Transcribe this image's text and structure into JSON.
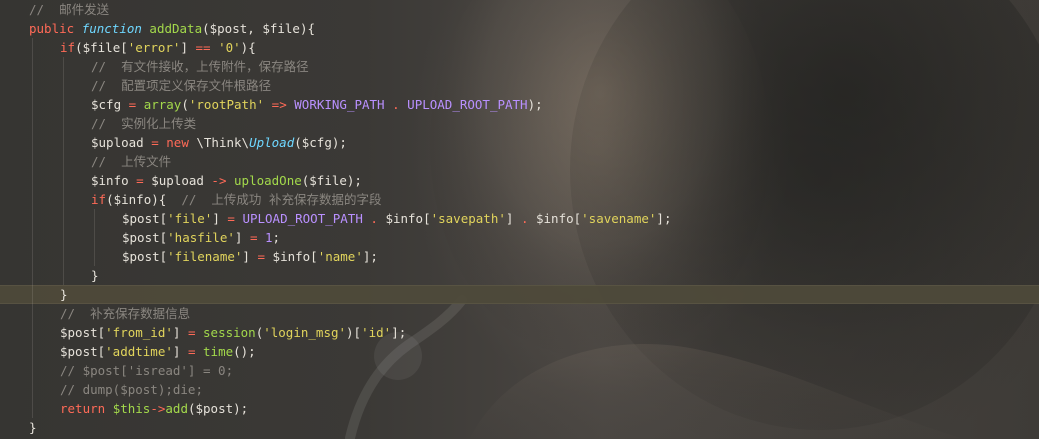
{
  "editor": {
    "lines": [
      {
        "indent": 1,
        "active": false,
        "tokens": [
          {
            "t": "//  邮件发送",
            "c": "cmt"
          }
        ]
      },
      {
        "indent": 1,
        "active": false,
        "tokens": [
          {
            "t": "public ",
            "c": "kw"
          },
          {
            "t": "function ",
            "c": "fnkw"
          },
          {
            "t": "addData",
            "c": "fn"
          },
          {
            "t": "($post, $file){",
            "c": "plain"
          }
        ]
      },
      {
        "indent": 2,
        "active": false,
        "tokens": [
          {
            "t": "if",
            "c": "kw"
          },
          {
            "t": "($file[",
            "c": "plain"
          },
          {
            "t": "'error'",
            "c": "str"
          },
          {
            "t": "] ",
            "c": "plain"
          },
          {
            "t": "==",
            "c": "op"
          },
          {
            "t": " ",
            "c": "plain"
          },
          {
            "t": "'0'",
            "c": "str"
          },
          {
            "t": "){",
            "c": "plain"
          }
        ]
      },
      {
        "indent": 3,
        "active": false,
        "tokens": [
          {
            "t": "//  有文件接收，上传附件，保存路径",
            "c": "cmt"
          }
        ]
      },
      {
        "indent": 3,
        "active": false,
        "tokens": [
          {
            "t": "//  配置项定义保存文件根路径",
            "c": "cmt"
          }
        ]
      },
      {
        "indent": 3,
        "active": false,
        "tokens": [
          {
            "t": "$cfg ",
            "c": "plain"
          },
          {
            "t": "=",
            "c": "op"
          },
          {
            "t": " ",
            "c": "plain"
          },
          {
            "t": "array",
            "c": "fn"
          },
          {
            "t": "(",
            "c": "plain"
          },
          {
            "t": "'rootPath'",
            "c": "str"
          },
          {
            "t": " ",
            "c": "plain"
          },
          {
            "t": "=>",
            "c": "op"
          },
          {
            "t": " ",
            "c": "plain"
          },
          {
            "t": "WORKING_PATH",
            "c": "const"
          },
          {
            "t": " ",
            "c": "plain"
          },
          {
            "t": ".",
            "c": "op"
          },
          {
            "t": " ",
            "c": "plain"
          },
          {
            "t": "UPLOAD_ROOT_PATH",
            "c": "const"
          },
          {
            "t": ");",
            "c": "plain"
          }
        ]
      },
      {
        "indent": 3,
        "active": false,
        "tokens": [
          {
            "t": "//  实例化上传类",
            "c": "cmt"
          }
        ]
      },
      {
        "indent": 3,
        "active": false,
        "tokens": [
          {
            "t": "$upload ",
            "c": "plain"
          },
          {
            "t": "=",
            "c": "op"
          },
          {
            "t": " ",
            "c": "plain"
          },
          {
            "t": "new",
            "c": "kw"
          },
          {
            "t": " \\Think\\",
            "c": "plain"
          },
          {
            "t": "Upload",
            "c": "cls"
          },
          {
            "t": "($cfg);",
            "c": "plain"
          }
        ]
      },
      {
        "indent": 3,
        "active": false,
        "tokens": [
          {
            "t": "//  上传文件",
            "c": "cmt"
          }
        ]
      },
      {
        "indent": 3,
        "active": false,
        "tokens": [
          {
            "t": "$info ",
            "c": "plain"
          },
          {
            "t": "=",
            "c": "op"
          },
          {
            "t": " $upload ",
            "c": "plain"
          },
          {
            "t": "->",
            "c": "op"
          },
          {
            "t": " ",
            "c": "plain"
          },
          {
            "t": "uploadOne",
            "c": "fn"
          },
          {
            "t": "($file);",
            "c": "plain"
          }
        ]
      },
      {
        "indent": 3,
        "active": false,
        "tokens": [
          {
            "t": "if",
            "c": "kw"
          },
          {
            "t": "($info){  ",
            "c": "plain"
          },
          {
            "t": "//  上传成功 补充保存数据的字段",
            "c": "cmt"
          }
        ]
      },
      {
        "indent": 4,
        "active": false,
        "tokens": [
          {
            "t": "$post[",
            "c": "plain"
          },
          {
            "t": "'file'",
            "c": "str"
          },
          {
            "t": "] ",
            "c": "plain"
          },
          {
            "t": "=",
            "c": "op"
          },
          {
            "t": " ",
            "c": "plain"
          },
          {
            "t": "UPLOAD_ROOT_PATH",
            "c": "const"
          },
          {
            "t": " ",
            "c": "plain"
          },
          {
            "t": ".",
            "c": "op"
          },
          {
            "t": " $info[",
            "c": "plain"
          },
          {
            "t": "'savepath'",
            "c": "str"
          },
          {
            "t": "] ",
            "c": "plain"
          },
          {
            "t": ".",
            "c": "op"
          },
          {
            "t": " $info[",
            "c": "plain"
          },
          {
            "t": "'savename'",
            "c": "str"
          },
          {
            "t": "];",
            "c": "plain"
          }
        ]
      },
      {
        "indent": 4,
        "active": false,
        "tokens": [
          {
            "t": "$post[",
            "c": "plain"
          },
          {
            "t": "'hasfile'",
            "c": "str"
          },
          {
            "t": "] ",
            "c": "plain"
          },
          {
            "t": "=",
            "c": "op"
          },
          {
            "t": " ",
            "c": "plain"
          },
          {
            "t": "1",
            "c": "num"
          },
          {
            "t": ";",
            "c": "plain"
          }
        ]
      },
      {
        "indent": 4,
        "active": false,
        "tokens": [
          {
            "t": "$post[",
            "c": "plain"
          },
          {
            "t": "'filename'",
            "c": "str"
          },
          {
            "t": "] ",
            "c": "plain"
          },
          {
            "t": "=",
            "c": "op"
          },
          {
            "t": " $info[",
            "c": "plain"
          },
          {
            "t": "'name'",
            "c": "str"
          },
          {
            "t": "];",
            "c": "plain"
          }
        ]
      },
      {
        "indent": 3,
        "active": false,
        "tokens": [
          {
            "t": "}",
            "c": "plain"
          }
        ]
      },
      {
        "indent": 2,
        "active": true,
        "tokens": [
          {
            "t": "}",
            "c": "plain"
          }
        ]
      },
      {
        "indent": 2,
        "active": false,
        "tokens": [
          {
            "t": "//  补充保存数据信息",
            "c": "cmt"
          }
        ]
      },
      {
        "indent": 2,
        "active": false,
        "tokens": [
          {
            "t": "$post[",
            "c": "plain"
          },
          {
            "t": "'from_id'",
            "c": "str"
          },
          {
            "t": "] ",
            "c": "plain"
          },
          {
            "t": "=",
            "c": "op"
          },
          {
            "t": " ",
            "c": "plain"
          },
          {
            "t": "session",
            "c": "fn"
          },
          {
            "t": "(",
            "c": "plain"
          },
          {
            "t": "'login_msg'",
            "c": "str"
          },
          {
            "t": ")[",
            "c": "plain"
          },
          {
            "t": "'id'",
            "c": "str"
          },
          {
            "t": "];",
            "c": "plain"
          }
        ]
      },
      {
        "indent": 2,
        "active": false,
        "tokens": [
          {
            "t": "$post[",
            "c": "plain"
          },
          {
            "t": "'addtime'",
            "c": "str"
          },
          {
            "t": "] ",
            "c": "plain"
          },
          {
            "t": "=",
            "c": "op"
          },
          {
            "t": " ",
            "c": "plain"
          },
          {
            "t": "time",
            "c": "fn"
          },
          {
            "t": "();",
            "c": "plain"
          }
        ]
      },
      {
        "indent": 2,
        "active": false,
        "tokens": [
          {
            "t": "// $post['isread'] = 0;",
            "c": "cmt"
          }
        ]
      },
      {
        "indent": 2,
        "active": false,
        "tokens": [
          {
            "t": "// dump($post);die;",
            "c": "cmt"
          }
        ]
      },
      {
        "indent": 2,
        "active": false,
        "tokens": [
          {
            "t": "return",
            "c": "kw"
          },
          {
            "t": " ",
            "c": "plain"
          },
          {
            "t": "$this",
            "c": "fn"
          },
          {
            "t": "->",
            "c": "op"
          },
          {
            "t": "add",
            "c": "fn"
          },
          {
            "t": "($post);",
            "c": "plain"
          }
        ]
      },
      {
        "indent": 1,
        "active": false,
        "tokens": [
          {
            "t": "}",
            "c": "plain"
          }
        ]
      }
    ]
  }
}
